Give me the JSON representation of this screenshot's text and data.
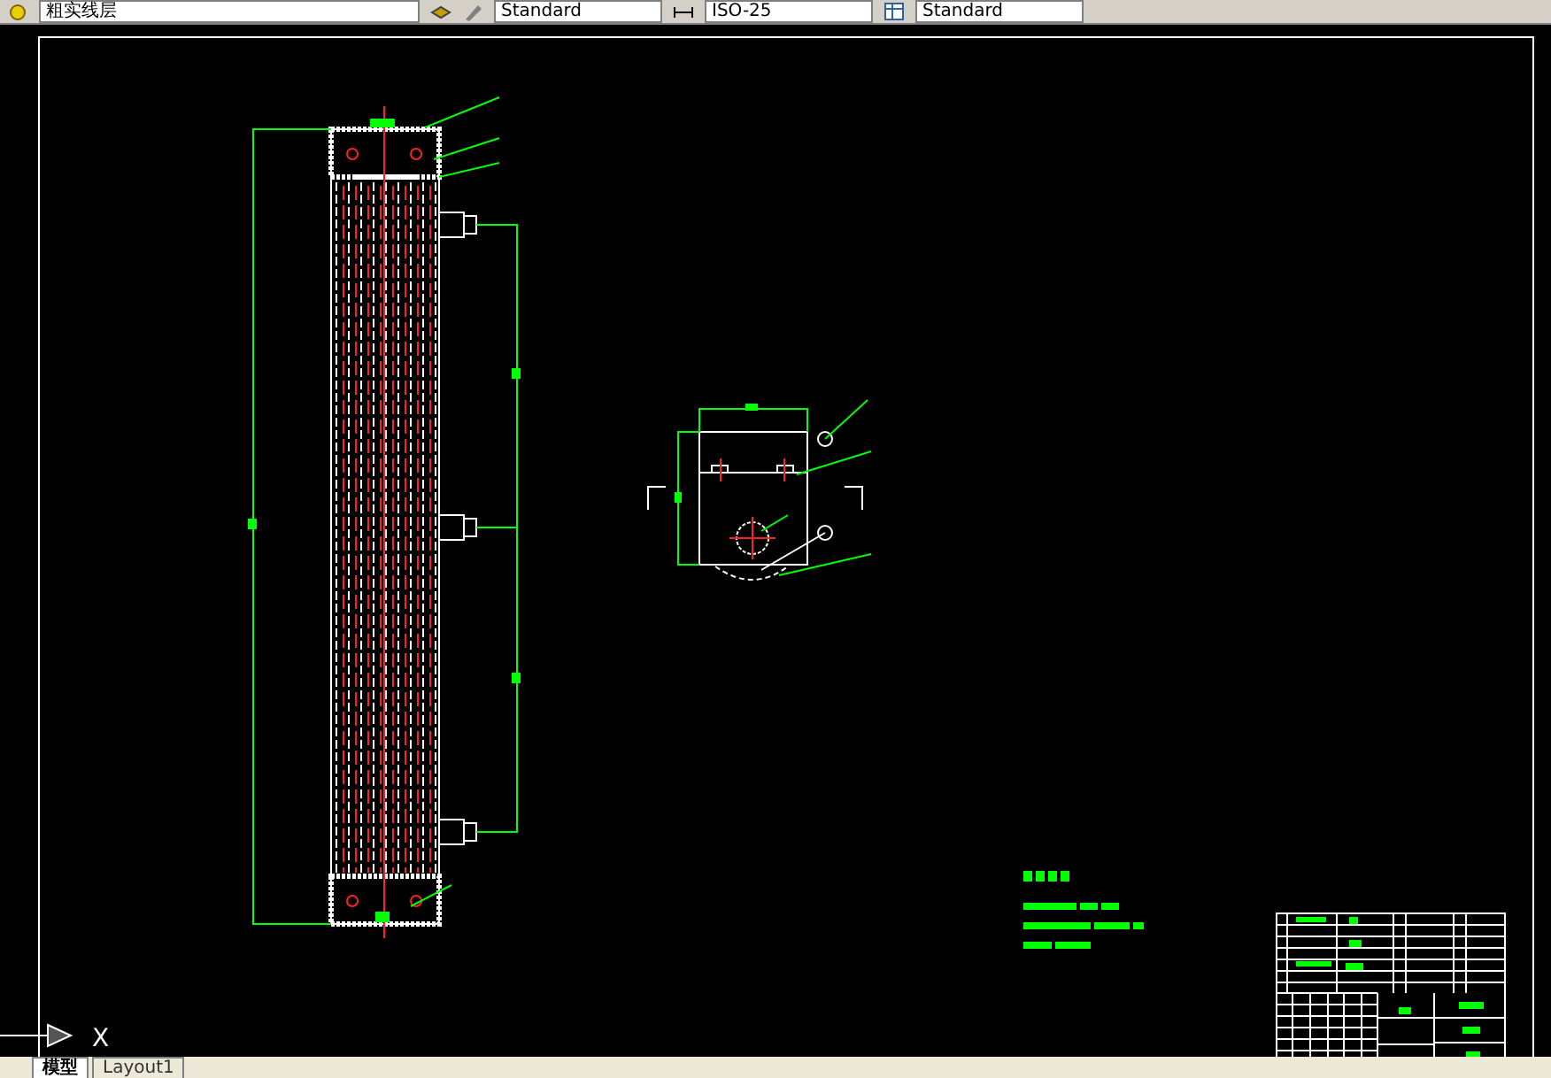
{
  "toolbar": {
    "layer": "粗实线层",
    "text_style": "Standard",
    "dim_style": "ISO-25",
    "table_style": "Standard"
  },
  "ucs": {
    "axis_label": "X"
  },
  "tabs": [
    {
      "label": "模型",
      "selected": true
    },
    {
      "label": "Layout1",
      "selected": false
    }
  ]
}
